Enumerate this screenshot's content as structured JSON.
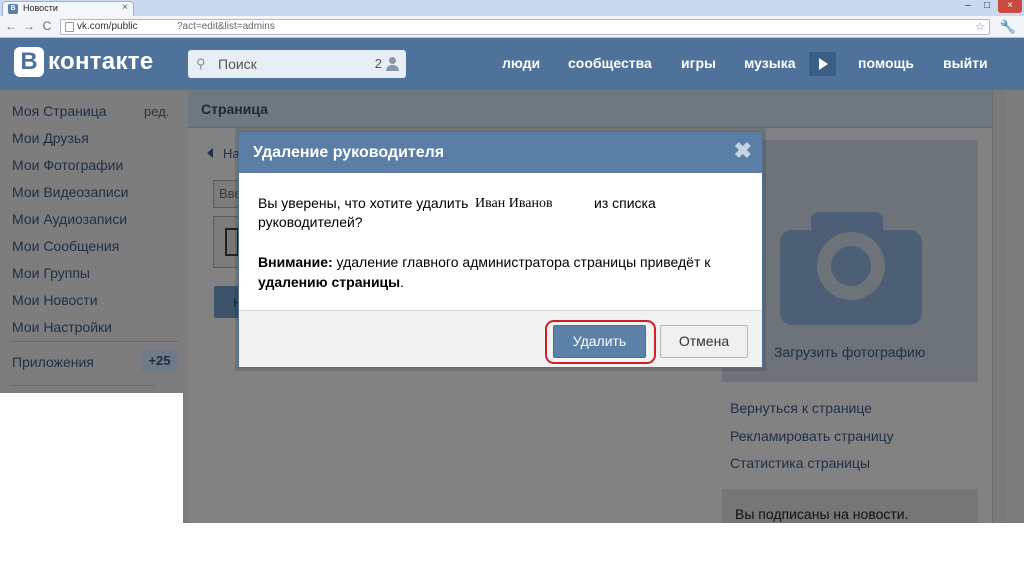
{
  "browser": {
    "tab_title": "Новости",
    "tab_close": "×",
    "fav_letter": "B",
    "nav_back": "←",
    "nav_forward": "→",
    "nav_reload": "C",
    "url_host": "vk.com/public",
    "url_path": "?act=edit&list=admins",
    "star": "☆",
    "wrench": "🔧",
    "win_min": "–",
    "win_max": "□",
    "win_close": "×"
  },
  "header": {
    "logo_letter": "В",
    "logo_text": "контакте",
    "search_placeholder": "Поиск",
    "search_count": "2",
    "nav": [
      "люди",
      "сообщества",
      "игры",
      "музыка",
      "помощь",
      "выйти"
    ]
  },
  "left_nav": {
    "items": [
      "Моя Страница",
      "Мои Друзья",
      "Мои Фотографии",
      "Мои Видеозаписи",
      "Мои Аудиозаписи",
      "Мои Сообщения",
      "Мои Группы",
      "Мои Новости",
      "Мои Настройки"
    ],
    "edit_label": "ред.",
    "apps_label": "Приложения",
    "apps_badge": "+25"
  },
  "content": {
    "title": "Страница",
    "back_text": "На",
    "form_placeholder": "Вве",
    "form_button": "Н",
    "upload_label": "Загрузить фотографию",
    "side_links": [
      "Вернуться к странице",
      "Рекламировать страницу",
      "Статистика страницы"
    ],
    "subscribed_text": "Вы подписаны на новости."
  },
  "modal": {
    "title": "Удаление руководителя",
    "close": "✖",
    "text_before": "Вы уверены, что хотите удалить",
    "name": "Иван Иванов",
    "text_after": "из списка",
    "text_line2": "руководителей?",
    "warning_label": "Внимание:",
    "warning_text": "удаление главного администратора страницы приведёт к",
    "warning_bold": "удалению страницы",
    "warning_end": ".",
    "delete_button": "Удалить",
    "cancel_button": "Отмена"
  },
  "colors": {
    "vk_blue": "#4e729a",
    "modal_header": "#5a7ea5",
    "highlight": "#cf2024"
  }
}
